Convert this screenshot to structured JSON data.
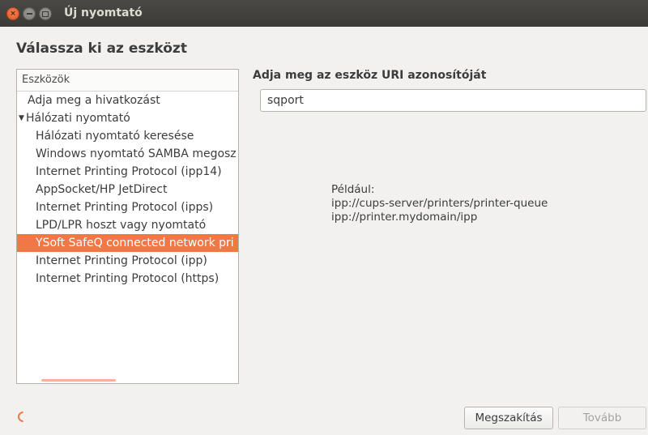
{
  "window": {
    "title": "Új nyomtató",
    "close_glyph": "×"
  },
  "heading": "Válassza ki az eszközt",
  "devices": {
    "header": "Eszközök",
    "items": [
      {
        "label": "Adja meg a hivatkozást",
        "level": 0,
        "selected": false
      },
      {
        "label": "Hálózati nyomtató",
        "level": 0,
        "expanded": true,
        "selected": false
      },
      {
        "label": "Hálózati nyomtató keresése",
        "level": 1,
        "selected": false
      },
      {
        "label": "Windows nyomtató SAMBA megosz",
        "level": 1,
        "selected": false
      },
      {
        "label": "Internet Printing Protocol (ipp14)",
        "level": 1,
        "selected": false
      },
      {
        "label": "AppSocket/HP JetDirect",
        "level": 1,
        "selected": false
      },
      {
        "label": "Internet Printing Protocol (ipps)",
        "level": 1,
        "selected": false
      },
      {
        "label": "LPD/LPR hoszt vagy nyomtató",
        "level": 1,
        "selected": false
      },
      {
        "label": "YSoft SafeQ connected network pri",
        "level": 1,
        "selected": true
      },
      {
        "label": "Internet Printing Protocol (ipp)",
        "level": 1,
        "selected": false
      },
      {
        "label": "Internet Printing Protocol (https)",
        "level": 1,
        "selected": false
      }
    ]
  },
  "uri": {
    "label": "Adja meg az eszköz URI azonosítóját",
    "value": "sqport"
  },
  "example": {
    "title": "Például:",
    "line1": "ipp://cups-server/printers/printer-queue",
    "line2": "ipp://printer.mydomain/ipp"
  },
  "buttons": {
    "cancel": "Megszakítás",
    "next": "Tovább"
  },
  "colors": {
    "accent": "#f07746",
    "titlebar": "#3b3a36",
    "background": "#f2f1f0"
  },
  "icons": {
    "close": "close-icon",
    "minimize": "minimize-icon",
    "maximize": "maximize-icon",
    "expander": "triangle-down-icon",
    "spinner": "spinner-icon"
  }
}
